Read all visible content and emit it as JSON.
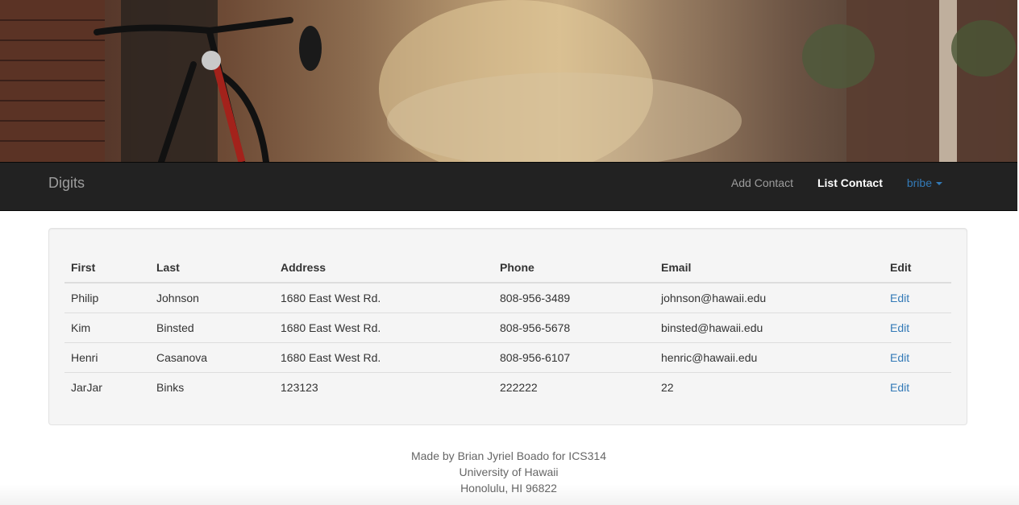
{
  "navbar": {
    "brand": "Digits",
    "links": {
      "add_contact": "Add Contact",
      "list_contact": "List Contact",
      "user": "bribe"
    }
  },
  "table": {
    "headers": [
      "First",
      "Last",
      "Address",
      "Phone",
      "Email",
      "Edit"
    ],
    "rows": [
      {
        "first": "Philip",
        "last": "Johnson",
        "address": "1680 East West Rd.",
        "phone": "808-956-3489",
        "email": "johnson@hawaii.edu",
        "edit": "Edit"
      },
      {
        "first": "Kim",
        "last": "Binsted",
        "address": "1680 East West Rd.",
        "phone": "808-956-5678",
        "email": "binsted@hawaii.edu",
        "edit": "Edit"
      },
      {
        "first": "Henri",
        "last": "Casanova",
        "address": "1680 East West Rd.",
        "phone": "808-956-6107",
        "email": "henric@hawaii.edu",
        "edit": "Edit"
      },
      {
        "first": "JarJar",
        "last": "Binks",
        "address": "123123",
        "phone": "222222",
        "email": "22",
        "edit": "Edit"
      }
    ]
  },
  "footer": {
    "line1": "Made by Brian Jyriel Boado for ICS314",
    "line2": "University of Hawaii",
    "line3": "Honolulu, HI 96822"
  },
  "colors": {
    "navbar_bg": "#222222",
    "link": "#337ab7",
    "well_bg": "#f5f5f5"
  }
}
